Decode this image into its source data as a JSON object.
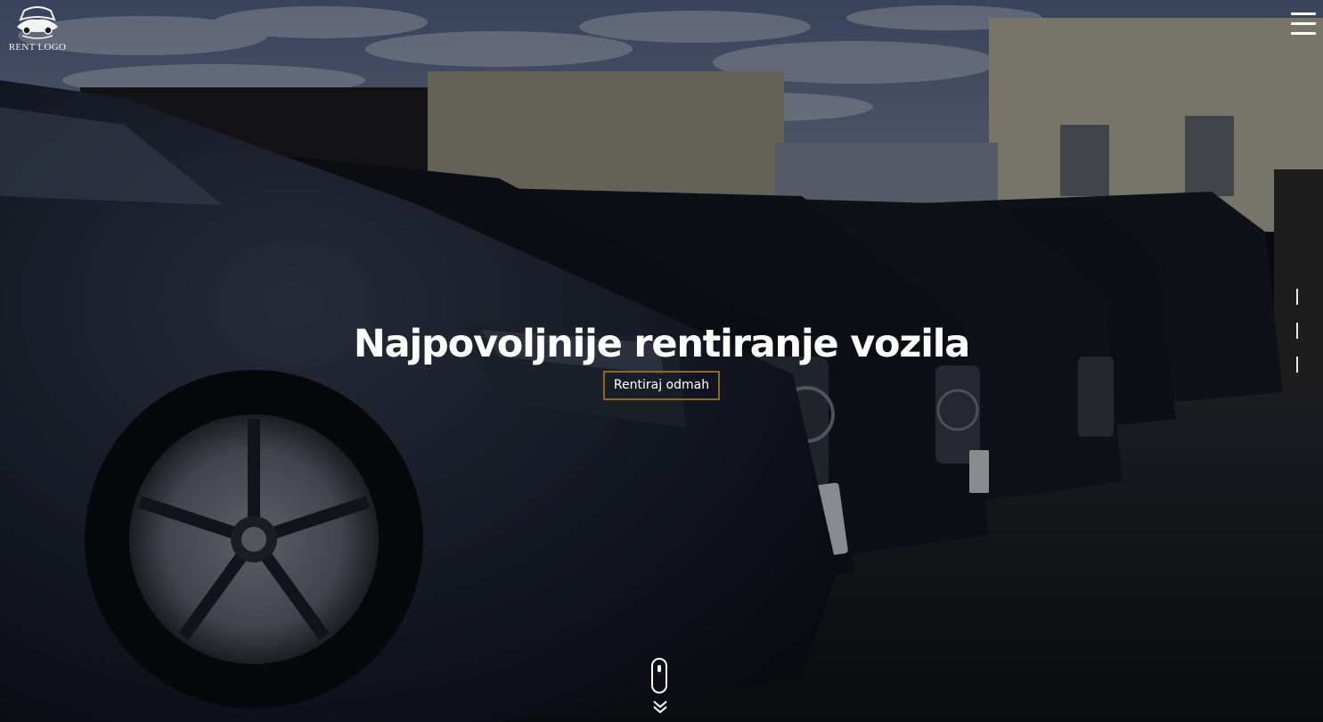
{
  "logo": {
    "text": "RENT LOGO",
    "icon": "car-emblem-icon"
  },
  "header": {
    "menu_icon": "hamburger-icon"
  },
  "hero": {
    "title": "Najpovoljnije rentiranje vozila",
    "cta_label": "Rentiraj odmah",
    "background": "black-cars-parked-row-photo"
  },
  "slider": {
    "slides": 3
  },
  "scroll": {
    "icon": "mouse-scroll-icon",
    "arrow_icon": "double-chevron-down-icon"
  },
  "colors": {
    "accent_border": "#8a6a2a",
    "text": "#ffffff",
    "overlay": "#08090e"
  }
}
